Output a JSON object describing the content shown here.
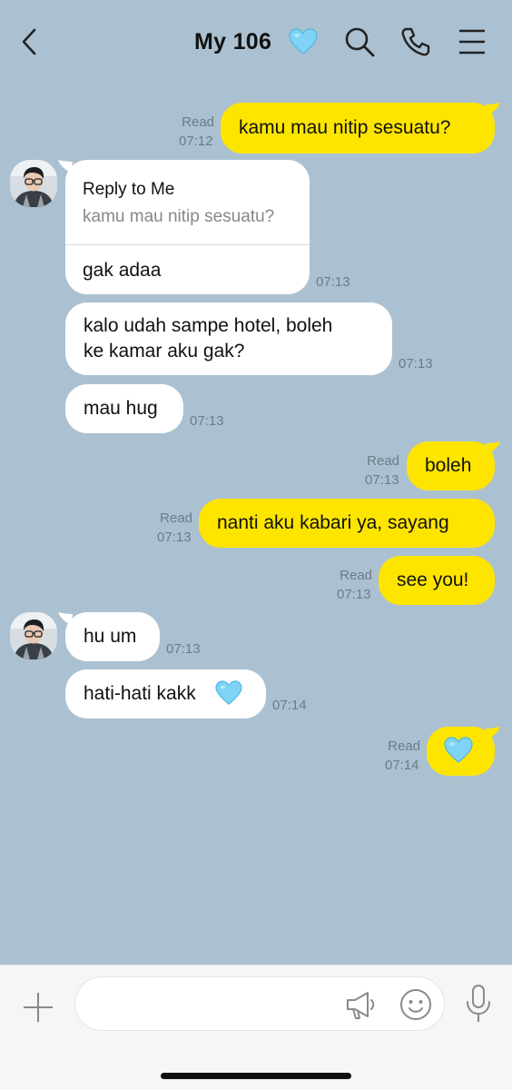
{
  "header": {
    "title": "My 106",
    "title_emoji": "light-blue-heart",
    "icons": [
      "back-chevron-icon",
      "search-icon",
      "phone-icon",
      "menu-icon"
    ]
  },
  "colors": {
    "background": "#ABC1D1",
    "my_bubble": "#FEE500",
    "their_bubble": "#FFFFFF",
    "heart": "#7FD3F5"
  },
  "messages": [
    {
      "from": "me",
      "text": "kamu mau nitip sesuatu?",
      "read": "Read",
      "time": "07:12"
    },
    {
      "from": "them",
      "reply_header": "Reply to Me",
      "reply_quote": "kamu mau nitip sesuatu?",
      "text": "gak adaa",
      "time": "07:13"
    },
    {
      "from": "them",
      "text_line1": "kalo udah sampe hotel, boleh",
      "text_line2": "ke kamar aku gak?",
      "time": "07:13"
    },
    {
      "from": "them",
      "text": "mau hug",
      "time": "07:13"
    },
    {
      "from": "me",
      "text": "boleh",
      "read": "Read",
      "time": "07:13"
    },
    {
      "from": "me",
      "text": "nanti aku kabari ya, sayang",
      "read": "Read",
      "time": "07:13"
    },
    {
      "from": "me",
      "text": "see you!",
      "read": "Read",
      "time": "07:13"
    },
    {
      "from": "them",
      "text": "hu um",
      "time": "07:13"
    },
    {
      "from": "them",
      "text": "hati-hati kakk",
      "emoji": "light-blue-heart",
      "time": "07:14"
    },
    {
      "from": "me",
      "emoji": "light-blue-heart",
      "read": "Read",
      "time": "07:14"
    }
  ],
  "composer": {
    "value": "",
    "placeholder": "",
    "icons": [
      "plus-icon",
      "megaphone-icon",
      "emoji-icon",
      "microphone-icon"
    ]
  }
}
